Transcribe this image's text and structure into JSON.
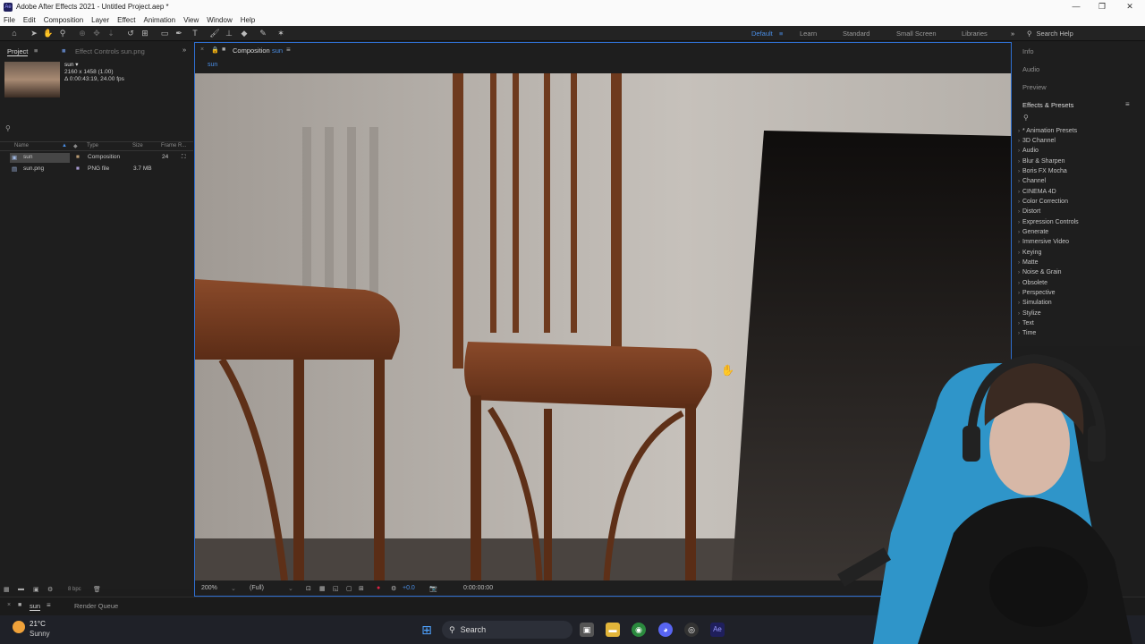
{
  "window": {
    "title": "Adobe After Effects 2021 - Untitled Project.aep *",
    "minimize": "—",
    "maximize": "❐",
    "close": "✕"
  },
  "menu": [
    "File",
    "Edit",
    "Composition",
    "Layer",
    "Effect",
    "Animation",
    "View",
    "Window",
    "Help"
  ],
  "workspaces": {
    "default": "Default",
    "learn": "Learn",
    "standard": "Standard",
    "small_screen": "Small Screen",
    "libraries": "Libraries",
    "search_help": "Search Help"
  },
  "project": {
    "tab_project": "Project",
    "tab_effect_controls": "Effect Controls sun.png",
    "item_name": "sun ▾",
    "item_dims": "2160 x 1458 (1.00)",
    "item_duration": "Δ 0:00:43:19, 24.00 fps",
    "search_placeholder": "",
    "columns": {
      "name": "Name",
      "type": "Type",
      "size": "Size",
      "frame_rate": "Frame R..."
    },
    "rows": [
      {
        "name": "sun",
        "type": "Composition",
        "size": "",
        "fps": "24"
      },
      {
        "name": "sun.png",
        "type": "PNG file",
        "size": "3.7 MB",
        "fps": ""
      }
    ],
    "bpc": "8 bpc"
  },
  "composition": {
    "tab_label": "Composition",
    "tab_comp": "sun",
    "sub_tab": "sun",
    "zoom": "200%",
    "resolution": "(Full)",
    "exposure": "+0.0",
    "timecode": "0:00:00:00"
  },
  "right": {
    "info": "Info",
    "audio": "Audio",
    "preview": "Preview",
    "effects_presets": "Effects & Presets",
    "effects": [
      "* Animation Presets",
      "3D Channel",
      "Audio",
      "Blur & Sharpen",
      "Boris FX Mocha",
      "Channel",
      "CINEMA 4D",
      "Color Correction",
      "Distort",
      "Expression Controls",
      "Generate",
      "Immersive Video",
      "Keying",
      "Matte",
      "Noise & Grain",
      "Obsolete",
      "Perspective",
      "Simulation",
      "Stylize",
      "Text",
      "Time"
    ]
  },
  "bottom": {
    "timeline_tab": "sun",
    "render_queue": "Render Queue"
  },
  "taskbar": {
    "temperature": "21°C",
    "weather": "Sunny",
    "search": "Search"
  },
  "colors": {
    "accent_blue": "#2f6fd1",
    "workspace_active": "#4a8ee6",
    "panel_bg": "#1e1e1e"
  }
}
